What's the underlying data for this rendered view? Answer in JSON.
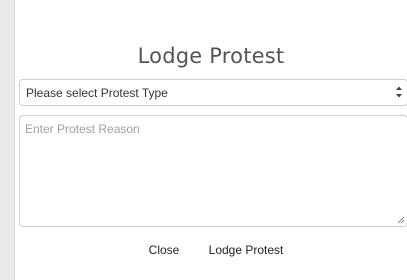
{
  "dialog": {
    "title": "Lodge Protest",
    "protest_type": {
      "selected": "Please select Protest Type",
      "arrows_icon": "select-updown-arrows-icon"
    },
    "reason": {
      "value": "",
      "placeholder": "Enter Protest Reason"
    },
    "buttons": {
      "close_label": "Close",
      "lodge_label": "Lodge Protest"
    }
  }
}
